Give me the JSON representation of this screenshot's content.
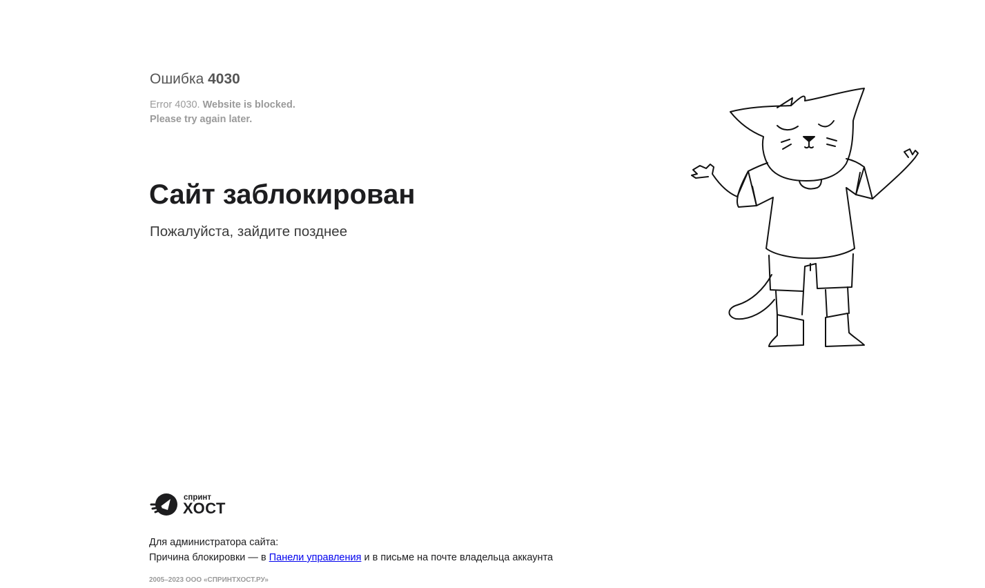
{
  "error": {
    "prefix": "Ошибка",
    "code": "4030",
    "en_prefix": "Error 4030.",
    "en_bold": "Website is blocked.",
    "en_line2": "Please try again later."
  },
  "headline": "Сайт заблокирован",
  "subline": "Пожалуйста, зайдите позднее",
  "logo": {
    "small": "спринт",
    "big": "ХОСТ",
    "icon": "rocket-icon"
  },
  "admin": {
    "line1": "Для администратора сайта:",
    "line2_before": "Причина блокировки — в",
    "link_text": "Панели управления",
    "line2_after": "и в письме на почте владельца аккаунта"
  },
  "copyright": "2005–2023 ООО «СПРИНТХОСТ.РУ»",
  "colors": {
    "text_dark": "#1d1d1f",
    "text_gray": "#9a9a9a",
    "link": "#0000ee"
  }
}
